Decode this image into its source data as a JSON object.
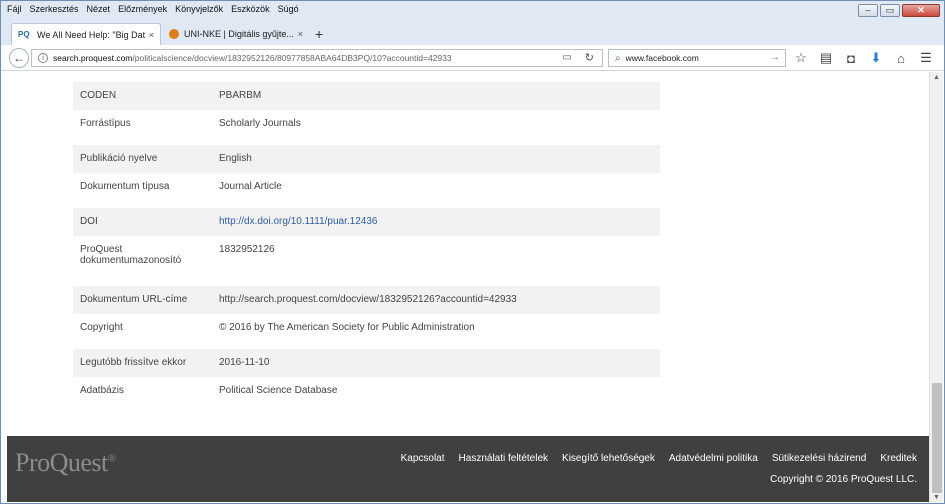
{
  "menubar": [
    "Fájl",
    "Szerkesztés",
    "Nézet",
    "Előzmények",
    "Könyvjelzők",
    "Eszközök",
    "Súgó"
  ],
  "tabs": [
    {
      "favicon": "PQ",
      "title": "We All Need Help: \"Big Dat...",
      "close": "×"
    },
    {
      "favicon": "",
      "title": "UNI-NKE | Digitális gyűjte...",
      "close": "×"
    }
  ],
  "newtab": "+",
  "url": {
    "host": "search.proquest.com",
    "path": "/politicalscience/docview/1832952126/80977858ABA64DB3PQ/10?accountid=42933"
  },
  "search": {
    "value": "www.facebook.com"
  },
  "details": [
    {
      "label": "CODEN",
      "value": "PBARBM"
    },
    {
      "label": "Forrástípus",
      "value": "Scholarly Journals"
    },
    {
      "label": "Publikáció nyelve",
      "value": "English"
    },
    {
      "label": "Dokumentum típusa",
      "value": "Journal Article"
    },
    {
      "label": "DOI",
      "value": "http://dx.doi.org/10.1111/puar.12436"
    },
    {
      "label": "ProQuest dokumentumazonosító",
      "value": "1832952126"
    },
    {
      "label": "Dokumentum URL-címe",
      "value": "http://search.proquest.com/docview/1832952126?accountid=42933"
    },
    {
      "label": "Copyright",
      "value": "© 2016 by The American Society for Public Administration"
    },
    {
      "label": "Legutóbb frissítve ekkor",
      "value": "2016-11-10"
    },
    {
      "label": "Adatbázis",
      "value": "Political Science Database"
    }
  ],
  "footer": {
    "logo": "ProQuest",
    "logo_mark": "®",
    "links": [
      "Kapcsolat",
      "Használati feltételek",
      "Kisegítő lehetőségek",
      "Adatvédelmi politika",
      "Sütikezelési házirend",
      "Kreditek"
    ],
    "copyright": "Copyright © 2016 ProQuest LLC."
  }
}
